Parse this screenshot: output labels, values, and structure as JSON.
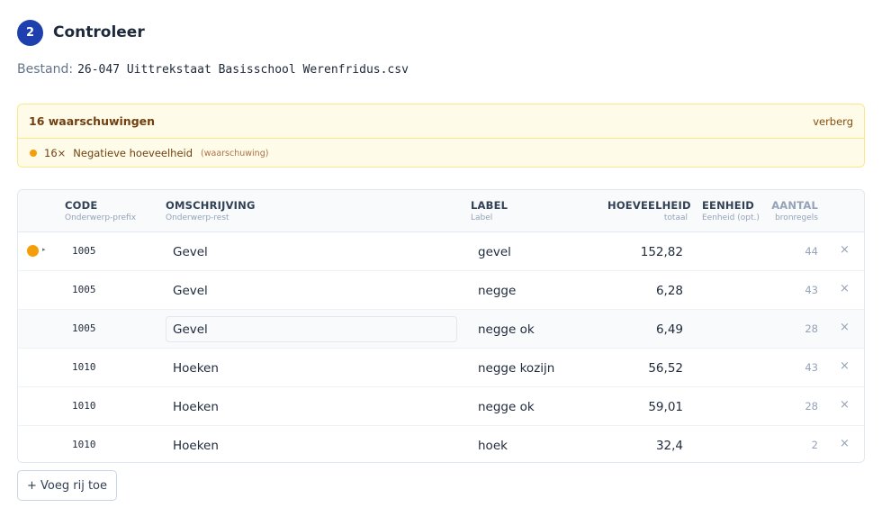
{
  "step": {
    "number": "2",
    "title": "Controleer"
  },
  "file": {
    "label": "Bestand:",
    "name": "26-047 Uittrekstaat Basisschool Werenfridus.csv"
  },
  "warnings": {
    "title": "16 waarschuwingen",
    "hide_label": "verberg",
    "items": [
      {
        "count": "16×",
        "message": "Negatieve hoeveelheid",
        "kind": "(waarschuwing)"
      }
    ]
  },
  "table": {
    "columns": {
      "code": {
        "title": "CODE",
        "sub": "Onderwerp-prefix"
      },
      "desc": {
        "title": "OMSCHRIJVING",
        "sub": "Onderwerp-rest"
      },
      "label": {
        "title": "LABEL",
        "sub": "Label"
      },
      "qty": {
        "title": "HOEVEELHEID",
        "sub": "totaal"
      },
      "unit": {
        "title": "EENHEID",
        "sub": "Eenheid (opt.)"
      },
      "count": {
        "title": "AANTAL",
        "sub": "bronregels"
      }
    },
    "rows": [
      {
        "code": "1005",
        "desc": "Gevel",
        "label": "gevel",
        "qty": "152,82",
        "unit": "",
        "count": "44",
        "remove": "×",
        "caret": "▸"
      },
      {
        "code": "1005",
        "desc": "Gevel",
        "label": "negge",
        "qty": "6,28",
        "unit": "",
        "count": "43",
        "remove": "×"
      },
      {
        "code": "1005",
        "desc": "Gevel",
        "label": "negge ok",
        "qty": "6,49",
        "unit": "",
        "count": "28",
        "remove": "×"
      },
      {
        "code": "1010",
        "desc": "Hoeken",
        "label": "negge kozijn",
        "qty": "56,52",
        "unit": "",
        "count": "43",
        "remove": "×"
      },
      {
        "code": "1010",
        "desc": "Hoeken",
        "label": "negge ok",
        "qty": "59,01",
        "unit": "",
        "count": "28",
        "remove": "×"
      },
      {
        "code": "1010",
        "desc": "Hoeken",
        "label": "hoek",
        "qty": "32,4",
        "unit": "",
        "count": "2",
        "remove": "×"
      }
    ]
  },
  "add_row_label": "+ Voeg rij toe",
  "colors": {
    "accent": "#1e40af",
    "warning": "#f59e0b",
    "warning_bg": "#fefce8"
  }
}
